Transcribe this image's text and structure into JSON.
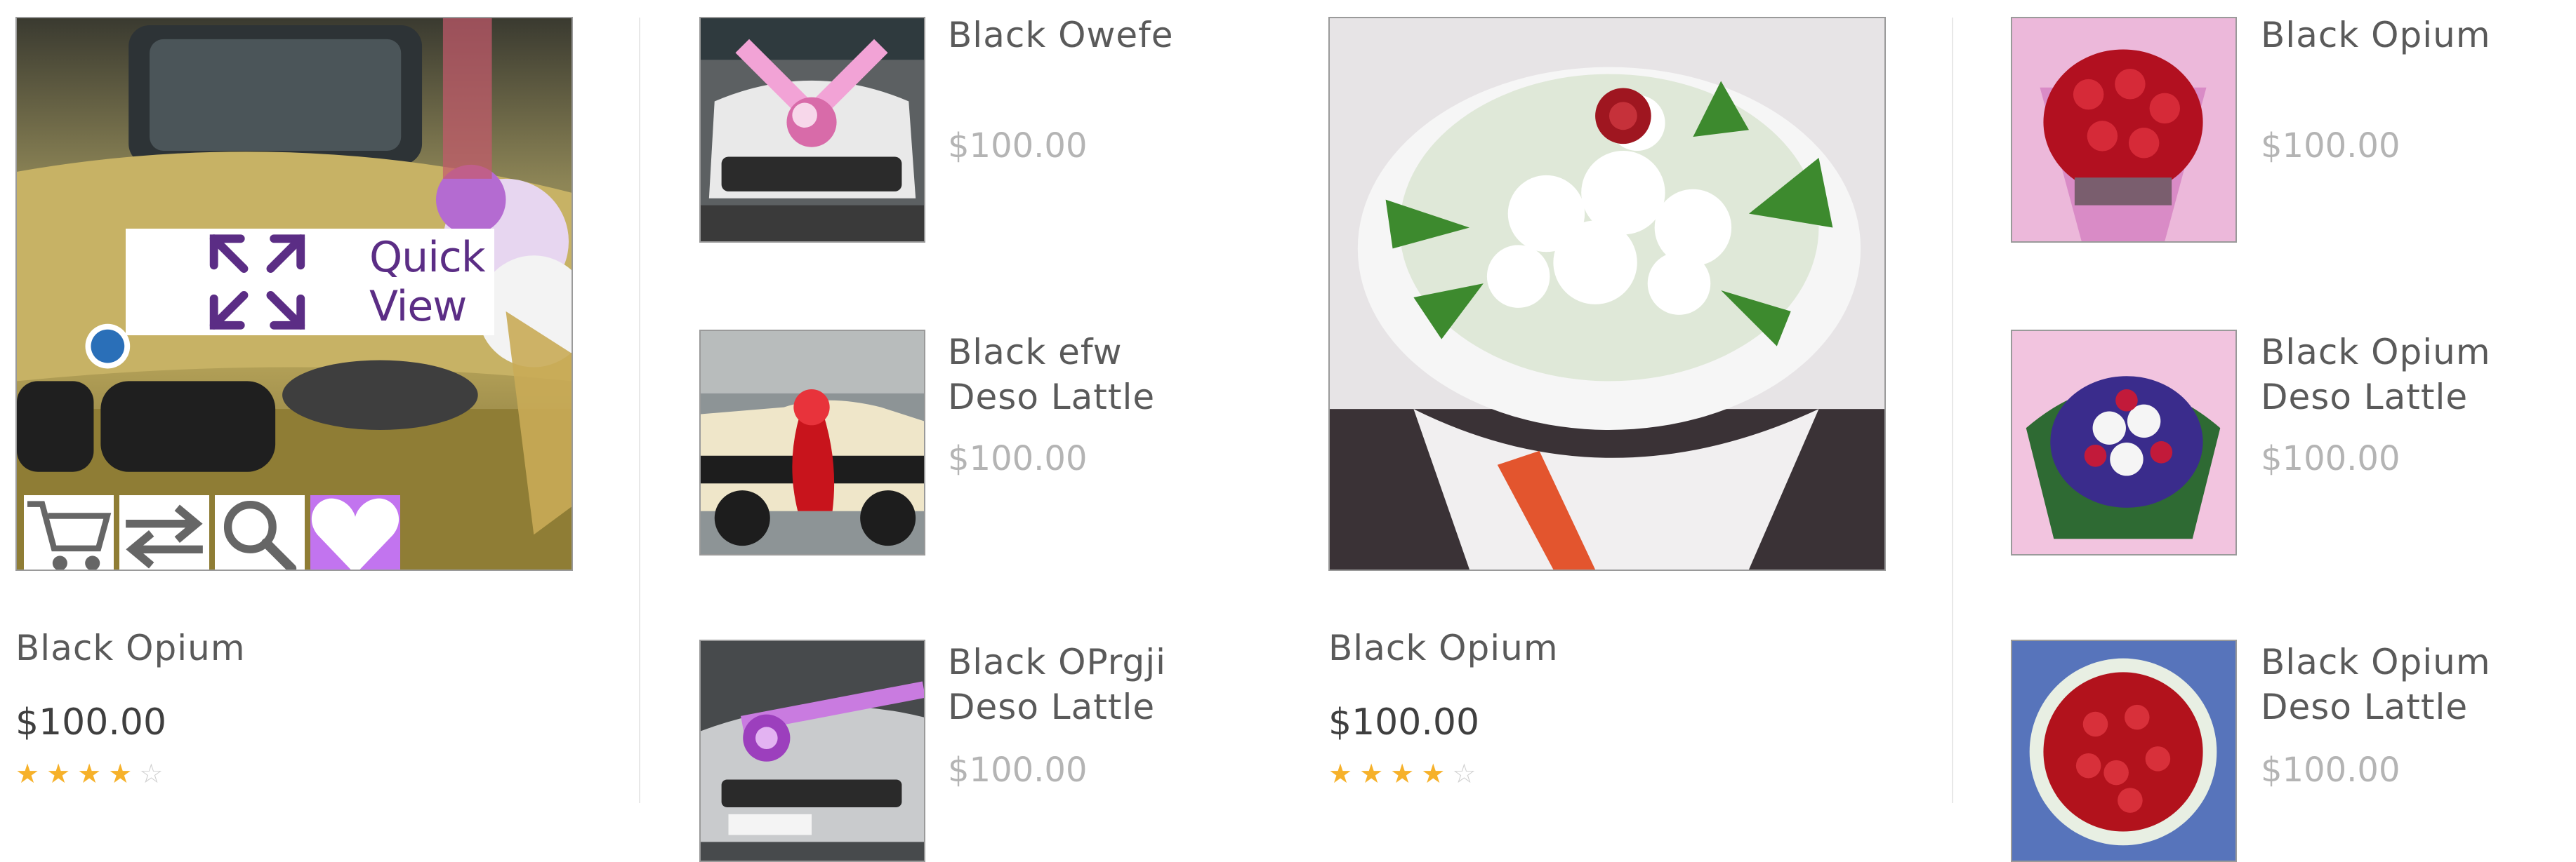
{
  "colors": {
    "accent": "#c274ef",
    "quickview_text": "#5b2d85",
    "star": "#f6b12a",
    "price_dark": "#3f3f3f",
    "price_light": "#b4b4b4"
  },
  "col1": {
    "quick_view_label": "Quick View",
    "quick_view_icon": "expand-arrows-icon",
    "actions": [
      "cart-icon",
      "compare-arrows-icon",
      "search-icon",
      "heart-icon"
    ],
    "title": "Black Opium",
    "price": "$100.00",
    "rating": {
      "value": 4,
      "max": 5
    }
  },
  "col2": {
    "items": [
      {
        "title_line1": "Black Owefe",
        "title_line2": "",
        "price": "$100.00"
      },
      {
        "title_line1": "Black efw",
        "title_line2": "Deso Lattle",
        "price": "$100.00"
      },
      {
        "title_line1": "Black OPrgji",
        "title_line2": "Deso Lattle",
        "price": "$100.00"
      }
    ]
  },
  "col3": {
    "title": "Black Opium",
    "price": "$100.00",
    "rating": {
      "value": 4,
      "max": 5
    }
  },
  "col4": {
    "items": [
      {
        "title_line1": "Black Opium",
        "title_line2": "",
        "price": "$100.00"
      },
      {
        "title_line1": "Black Opium",
        "title_line2": "Deso Lattle",
        "price": "$100.00"
      },
      {
        "title_line1": "Black Opium",
        "title_line2": "Deso Lattle",
        "price": "$100.00"
      }
    ]
  }
}
